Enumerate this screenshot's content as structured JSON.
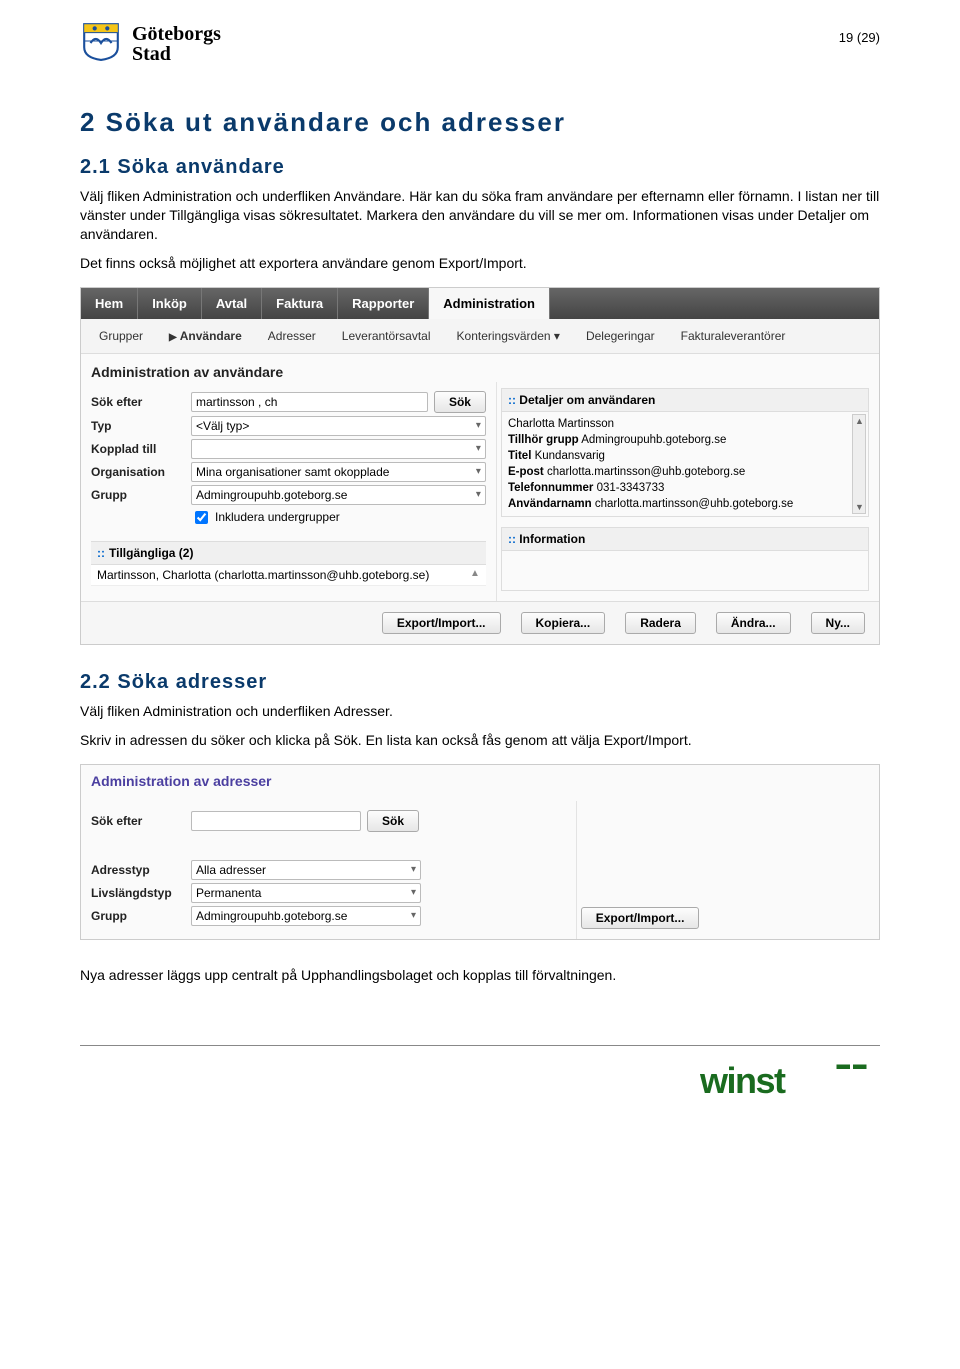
{
  "page": {
    "brand_line1": "Göteborgs",
    "brand_line2": "Stad",
    "page_number": "19 (29)"
  },
  "section": {
    "heading": "2 Söka ut användare och adresser",
    "sub1_heading": "2.1 Söka användare",
    "sub1_p1": "Välj fliken Administration och underfliken Användare. Här kan du söka fram användare per efternamn eller förnamn. I listan ner till vänster under Tillgängliga visas sökresultatet. Markera den användare du vill se mer om. Informationen visas under Detaljer om användaren.",
    "sub1_p2": "Det finns också möjlighet att exportera användare genom Export/Import.",
    "sub2_heading": "2.2 Söka adresser",
    "sub2_p1": "Välj fliken Administration och underfliken Adresser.",
    "sub2_p2": "Skriv in adressen du söker och klicka på Sök. En lista kan också fås genom att välja Export/Import.",
    "sub2_p3": "Nya adresser läggs upp centralt på Upphandlingsbolaget och kopplas till förvaltningen."
  },
  "shot1": {
    "tabs": [
      "Hem",
      "Inköp",
      "Avtal",
      "Faktura",
      "Rapporter",
      "Administration"
    ],
    "active_tab_index": 5,
    "subtabs": [
      "Grupper",
      "Användare",
      "Adresser",
      "Leverantörsavtal",
      "Konteringsvärden ▾",
      "Delegeringar",
      "Fakturaleverantörer"
    ],
    "active_subtab_index": 1,
    "panel_title": "Administration av användare",
    "form": {
      "sok_efter_label": "Sök efter",
      "sok_efter_value": "martinsson , ch",
      "sok_button": "Sök",
      "typ_label": "Typ",
      "typ_value": "<Välj typ>",
      "kopplad_label": "Kopplad till",
      "kopplad_value": "",
      "org_label": "Organisation",
      "org_value": "Mina organisationer samt okopplade",
      "grupp_label": "Grupp",
      "grupp_value": "Admingroupuhb.goteborg.se",
      "include_sub_label": "Inkludera undergrupper",
      "include_sub_checked": true
    },
    "tillgangliga": {
      "header": "Tillgängliga (2)",
      "row1": "Martinsson, Charlotta (charlotta.martinsson@uhb.goteborg.se)"
    },
    "details": {
      "header": "Detaljer om användaren",
      "name": "Charlotta Martinsson",
      "tillhor_label": "Tillhör grupp",
      "tillhor_value": "Admingroupuhb.goteborg.se",
      "titel_label": "Titel",
      "titel_value": "Kundansvarig",
      "epost_label": "E-post",
      "epost_value": "charlotta.martinsson@uhb.goteborg.se",
      "tel_label": "Telefonnummer",
      "tel_value": "031-3343733",
      "anv_label": "Användarnamn",
      "anv_value": "charlotta.martinsson@uhb.goteborg.se",
      "info_header": "Information"
    },
    "buttons": [
      "Export/Import...",
      "Kopiera...",
      "Radera",
      "Ändra...",
      "Ny..."
    ]
  },
  "shot2": {
    "panel_title": "Administration av adresser",
    "sok_efter_label": "Sök efter",
    "sok_efter_value": "",
    "sok_button": "Sök",
    "adresstyp_label": "Adresstyp",
    "adresstyp_value": "Alla adresser",
    "livsl_label": "Livslängdstyp",
    "livsl_value": "Permanenta",
    "grupp_label": "Grupp",
    "grupp_value": "Admingroupuhb.goteborg.se",
    "export_button": "Export/Import..."
  },
  "footer": {
    "logo_text": "winst"
  }
}
